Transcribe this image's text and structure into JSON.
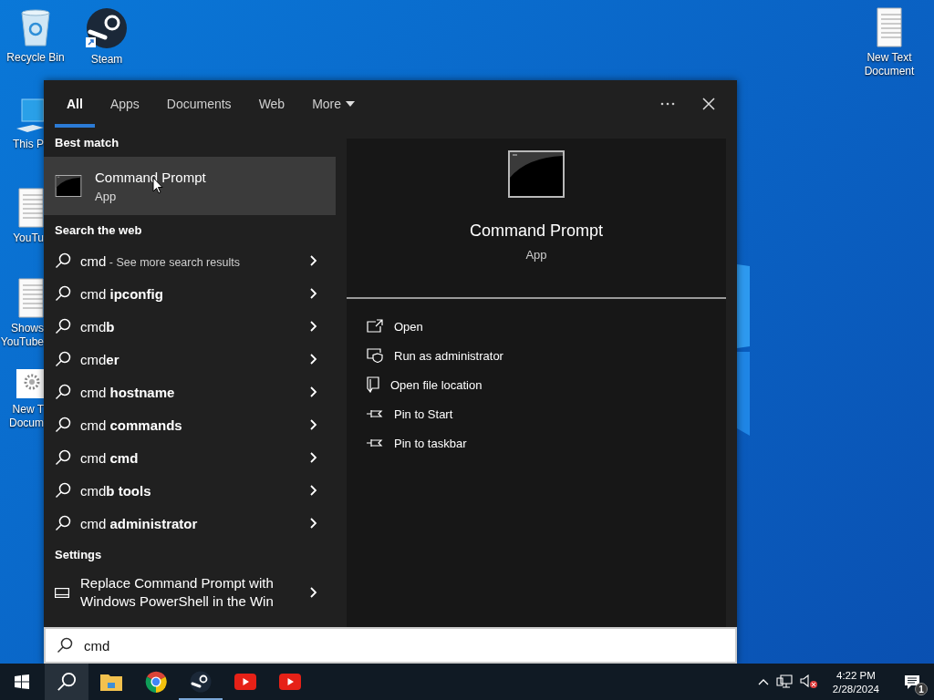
{
  "desktop": {
    "top_row": [
      {
        "kind": "recycle-bin",
        "label": [
          "Recycle Bin"
        ]
      },
      {
        "kind": "steam",
        "label": [
          "Steam"
        ]
      }
    ],
    "left_column": [
      {
        "kind": "computer",
        "label": [
          "This P"
        ]
      },
      {
        "kind": "document",
        "label": [
          "YouTu"
        ]
      },
      {
        "kind": "document",
        "label": [
          "Shows",
          "YouTube"
        ]
      },
      {
        "kind": "settings-file",
        "label": [
          "New T",
          "Docum"
        ]
      }
    ],
    "right_column": [
      {
        "kind": "document",
        "label": [
          "New Text",
          "Document"
        ]
      }
    ]
  },
  "search_panel": {
    "tabs": [
      {
        "label": "All",
        "selected": true
      },
      {
        "label": "Apps",
        "selected": false
      },
      {
        "label": "Documents",
        "selected": false
      },
      {
        "label": "Web",
        "selected": false
      },
      {
        "label": "More",
        "selected": false,
        "dropdown": true
      }
    ],
    "sections": [
      {
        "heading": "Best match",
        "items": [
          {
            "kind": "app",
            "title": "Command Prompt",
            "subtitle": "App",
            "selected": true
          }
        ]
      },
      {
        "heading": "Search the web",
        "items": [
          {
            "kind": "web",
            "text": "cmd",
            "detail": "- See more search results",
            "selected": false
          },
          {
            "kind": "web",
            "text": "cmd **ipconfig**",
            "selected": false
          },
          {
            "kind": "web",
            "text": "cmd**b**",
            "selected": false
          },
          {
            "kind": "web",
            "text": "cmd**er**",
            "selected": false
          },
          {
            "kind": "web",
            "text": "cmd **hostname**",
            "selected": false
          },
          {
            "kind": "web",
            "text": "cmd **commands**",
            "selected": false
          },
          {
            "kind": "web",
            "text": "cmd **cmd**",
            "selected": false
          },
          {
            "kind": "web",
            "text": "cmd**b tools**",
            "selected": false
          },
          {
            "kind": "web",
            "text": "cmd **administrator**",
            "selected": false
          }
        ]
      },
      {
        "heading": "Settings",
        "items": [
          {
            "kind": "setting",
            "lines": [
              "Replace Command Prompt with",
              "Windows PowerShell in the Win"
            ],
            "selected": false
          }
        ]
      }
    ],
    "preview": {
      "title": "Command Prompt",
      "subtitle": "App",
      "actions": [
        {
          "kind": "open",
          "label": "Open"
        },
        {
          "kind": "admin",
          "label": "Run as administrator"
        },
        {
          "kind": "folder",
          "label": "Open file location"
        },
        {
          "kind": "pin",
          "label": "Pin to Start"
        },
        {
          "kind": "pin",
          "label": "Pin to taskbar"
        }
      ]
    },
    "query": "cmd"
  },
  "taskbar": {
    "items": [
      {
        "kind": "start",
        "active": false,
        "running": false
      },
      {
        "kind": "search",
        "active": true,
        "running": false
      },
      {
        "kind": "explorer",
        "active": false,
        "running": false
      },
      {
        "kind": "chrome",
        "active": false,
        "running": false
      },
      {
        "kind": "steam",
        "active": false,
        "running": true
      },
      {
        "kind": "youtube",
        "active": false,
        "running": false
      },
      {
        "kind": "youtube",
        "active": false,
        "running": false
      }
    ],
    "time": "4:22 PM",
    "date": "2/28/2024",
    "notifications": "1"
  }
}
